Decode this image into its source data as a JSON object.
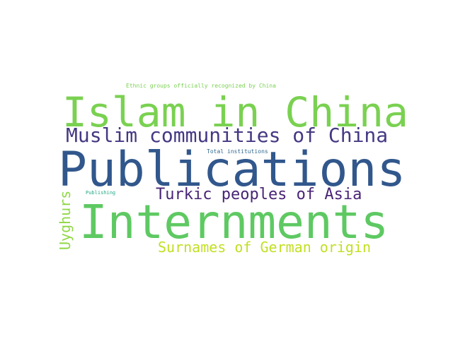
{
  "word_cloud": {
    "words": [
      {
        "id": "ethnic-groups",
        "text": "Ethnic groups officially recognized by China",
        "color": "#7ad151"
      },
      {
        "id": "islam-in-china",
        "text": "Islam in China",
        "color": "#7ad151"
      },
      {
        "id": "muslim-communities",
        "text": "Muslim communities of China",
        "color": "#443983"
      },
      {
        "id": "total-institutions",
        "text": "Total institutions",
        "color": "#31688e"
      },
      {
        "id": "publications",
        "text": "Publications",
        "color": "#31578c"
      },
      {
        "id": "uyghurs",
        "text": "Uyghurs",
        "color": "#8fd744"
      },
      {
        "id": "publishing",
        "text": "Publishing",
        "color": "#22a884"
      },
      {
        "id": "turkic-peoples",
        "text": "Turkic peoples of Asia",
        "color": "#482475"
      },
      {
        "id": "internments",
        "text": "Internments",
        "color": "#5ec962"
      },
      {
        "id": "surnames",
        "text": "Surnames of German origin",
        "color": "#c2df23"
      }
    ]
  }
}
